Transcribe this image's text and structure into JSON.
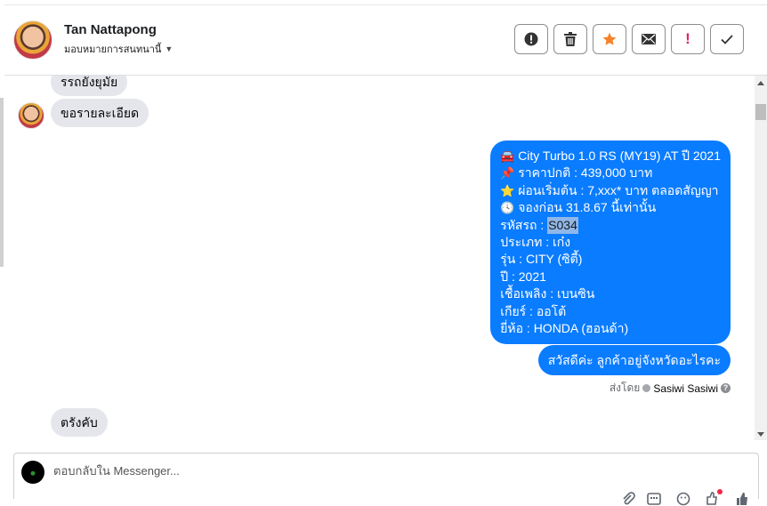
{
  "header": {
    "name": "Tan Nattapong",
    "assign_label": "มอบหมายการสนทนานี้",
    "actions": [
      {
        "name": "spam",
        "glyph": "!"
      },
      {
        "name": "delete"
      },
      {
        "name": "star"
      },
      {
        "name": "mail"
      },
      {
        "name": "important",
        "glyph": "!"
      },
      {
        "name": "done",
        "glyph": "✓"
      }
    ]
  },
  "messages": {
    "incoming_top_cut": "รรถยังยุมัย",
    "incoming_1": "ขอรายละเอียด",
    "outgoing_details": [
      {
        "icon": "car-icon",
        "emoji": "🚘",
        "text": "City Turbo 1.0 RS (MY19) AT ปี 2021"
      },
      {
        "icon": "pin-icon",
        "emoji": "📌",
        "text": "ราคาปกติ : 439,000 บาท"
      },
      {
        "icon": "star-icon",
        "emoji": "⭐",
        "text": "ผ่อนเริ่มต้น : 7,xxx* บาท ตลอดสัญญา"
      },
      {
        "icon": "clock-icon",
        "emoji": "🕓",
        "text": "จองก่อน 31.8.67 นี้เท่านั้น"
      },
      {
        "icon": "",
        "emoji": "",
        "text": "รหัสรถ : ",
        "highlight": "S034"
      },
      {
        "icon": "",
        "emoji": "",
        "text": "ประเภท : เก๋ง"
      },
      {
        "icon": "",
        "emoji": "",
        "text": "รุ่น : CITY (ซิตี้)"
      },
      {
        "icon": "",
        "emoji": "",
        "text": "ปี : 2021"
      },
      {
        "icon": "",
        "emoji": "",
        "text": "เชื้อเพลิง : เบนซิน"
      },
      {
        "icon": "",
        "emoji": "",
        "text": "เกียร์ : ออโต้"
      },
      {
        "icon": "",
        "emoji": "",
        "text": "ยี่ห้อ : HONDA (ฮอนด้า)"
      }
    ],
    "outgoing_greeting": "สวัสดีค่ะ ลูกค้าอยู่จังหวัดอะไรคะ",
    "sent_by_label": "ส่งโดย",
    "sent_by_name": "Sasiwi Sasiwi",
    "incoming_2": "ตรังคับ"
  },
  "composer": {
    "placeholder": "ตอบกลับใน Messenger..."
  },
  "colors": {
    "outgoing_bubble": "#0a7cff",
    "incoming_bubble": "#e4e6eb",
    "star_action": "#f5822a",
    "important_action": "#e0245e"
  }
}
